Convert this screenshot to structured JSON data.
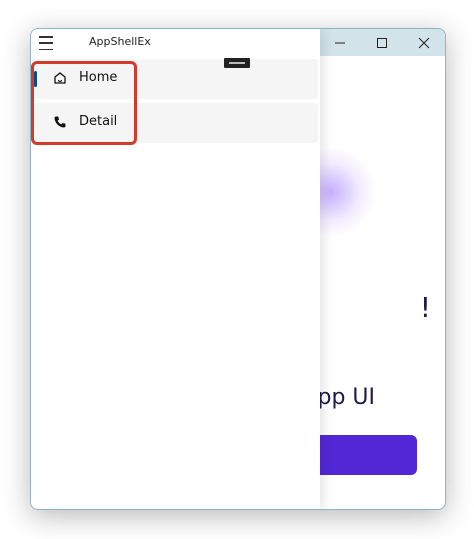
{
  "window": {
    "title": "AppShellEx",
    "caption": {
      "minimize_icon": "minimize-icon",
      "maximize_icon": "maximize-icon",
      "close_icon": "close-icon"
    }
  },
  "nav": {
    "menu_icon": "hamburger-icon",
    "items": [
      {
        "label": "Home",
        "icon": "home-icon",
        "selected": true
      },
      {
        "label": "Detail",
        "icon": "phone-icon",
        "selected": false
      }
    ]
  },
  "page": {
    "hero_fragment": "!",
    "subtitle_fragment": "pp UI"
  },
  "colors": {
    "titlebar": "#d3e3ea",
    "accent": "#5228d6",
    "selection_indicator": "#0a4a8a",
    "highlight": "#d23a2c"
  }
}
